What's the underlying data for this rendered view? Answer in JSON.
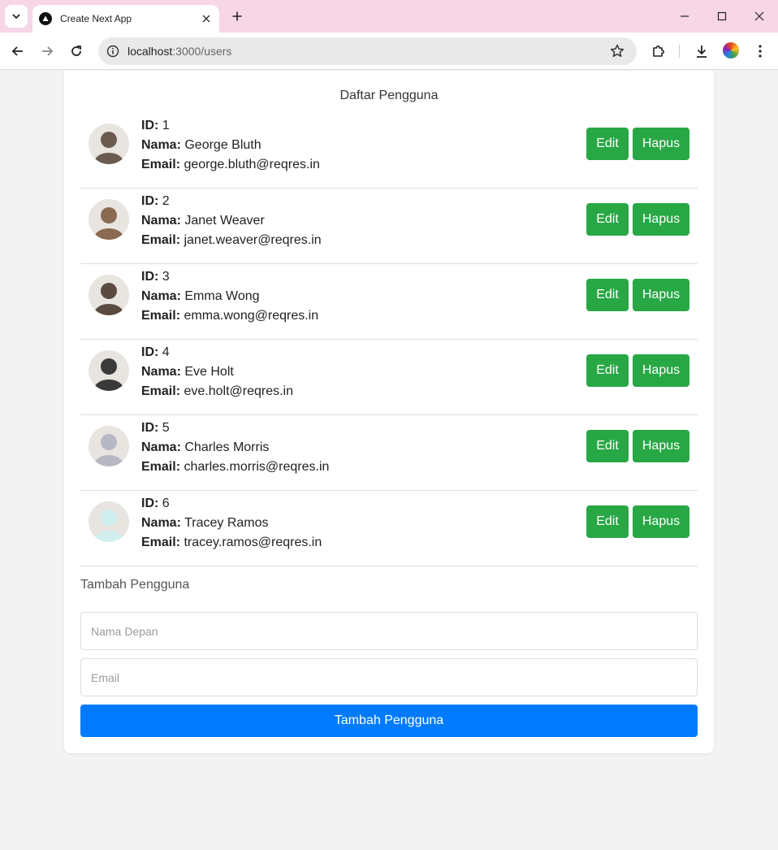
{
  "browser": {
    "tab_title": "Create Next App",
    "url_host": "localhost",
    "url_path": ":3000/users"
  },
  "page": {
    "title": "Daftar Pengguna",
    "labels": {
      "id": "ID:",
      "name": "Nama:",
      "email": "Email:"
    },
    "edit_label": "Edit",
    "delete_label": "Hapus",
    "users": [
      {
        "id": "1",
        "name": "George Bluth",
        "email": "george.bluth@reqres.in",
        "avatar_color": "#6b5a4e"
      },
      {
        "id": "2",
        "name": "Janet Weaver",
        "email": "janet.weaver@reqres.in",
        "avatar_color": "#8a6a52"
      },
      {
        "id": "3",
        "name": "Emma Wong",
        "email": "emma.wong@reqres.in",
        "avatar_color": "#5a4a40"
      },
      {
        "id": "4",
        "name": "Eve Holt",
        "email": "eve.holt@reqres.in",
        "avatar_color": "#3a3a3a"
      },
      {
        "id": "5",
        "name": "Charles Morris",
        "email": "charles.morris@reqres.in",
        "avatar_color": "#b8b8c4"
      },
      {
        "id": "6",
        "name": "Tracey Ramos",
        "email": "tracey.ramos@reqres.in",
        "avatar_color": "#d2eff0"
      }
    ],
    "add_form": {
      "title": "Tambah Pengguna",
      "first_name_placeholder": "Nama Depan",
      "email_placeholder": "Email",
      "submit_label": "Tambah Pengguna"
    }
  },
  "colors": {
    "accent_green": "#28a745",
    "accent_blue": "#007bff",
    "titlebar": "#f7d6e6"
  }
}
